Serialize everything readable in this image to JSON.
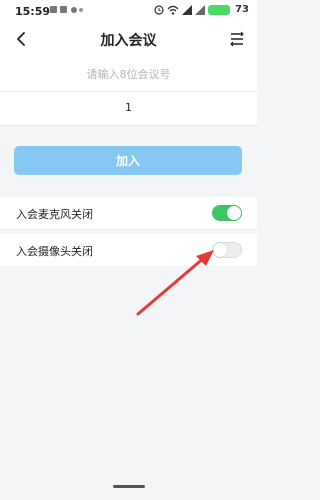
{
  "status_bar": {
    "time": "15:59",
    "battery": "73"
  },
  "header": {
    "title": "加入会议"
  },
  "form": {
    "meeting_id_placeholder": "请输入8位会议号",
    "name_value": "1"
  },
  "join_button": {
    "label": "加入"
  },
  "options": [
    {
      "label": "入会麦克风关闭",
      "state": "on"
    },
    {
      "label": "入会摄像头关闭",
      "state": "off"
    }
  ],
  "colors": {
    "accent": "#86c7f4",
    "switch_on": "#3fc464",
    "annotation_arrow": "#e53935"
  },
  "icons": [
    "back-arrow-icon",
    "menu-icon",
    "alarm-icon",
    "signal-icon",
    "wifi-icon",
    "battery-icon"
  ]
}
